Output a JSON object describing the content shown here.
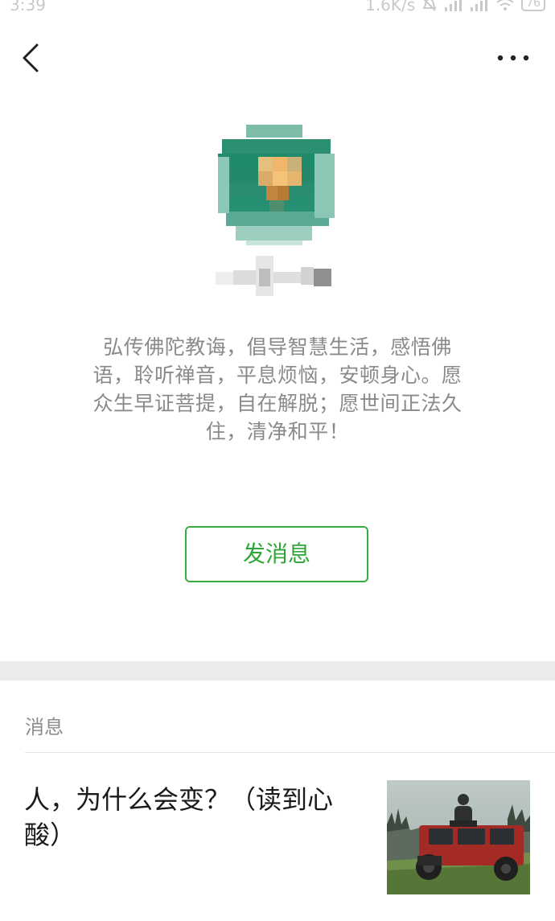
{
  "status_bar": {
    "time": "3:39",
    "network_speed": "1.6K/s",
    "battery": "76"
  },
  "nav": {
    "back_icon": "chevron-left-icon",
    "more_icon": "more-dots-icon"
  },
  "profile": {
    "bio": "弘传佛陀教诲，倡导智慧生活，感悟佛语，聆听禅音，平息烦恼，安顿身心。愿众生早证菩提，自在解脱；愿世间正法久住，清净和平！",
    "send_button_label": "发消息"
  },
  "messages": {
    "section_title": "消息",
    "items": [
      {
        "title": "人，为什么会变？（读到心酸）"
      }
    ]
  },
  "colors": {
    "accent": "#3bab45",
    "bio_text": "#8a8a8a",
    "section_gap": "#ececec"
  }
}
